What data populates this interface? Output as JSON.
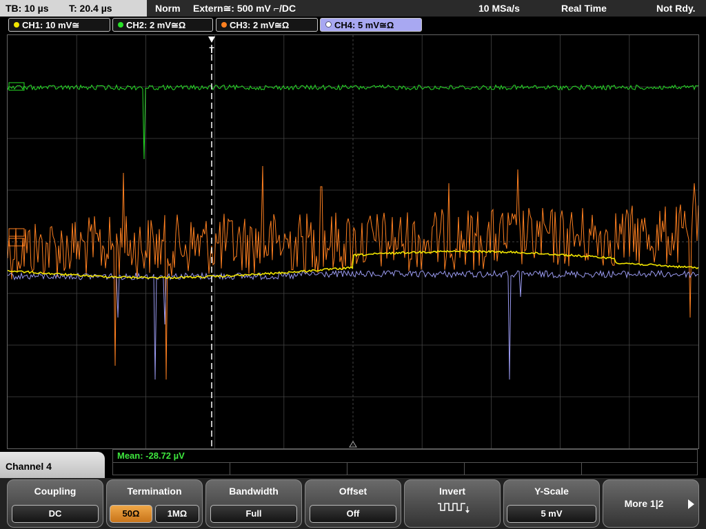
{
  "status": {
    "timebase": "TB: 10 µs",
    "trigger_time": "T: 20.4 µs",
    "mode": "Norm",
    "trigger_source": "Extern≅: 500 mV ⌐/DC",
    "sample_rate": "10 MSa/s",
    "acquisition": "Real Time",
    "state": "Not Rdy."
  },
  "channels": [
    {
      "label": "CH1: 10 mV≅",
      "color": "#f2e600"
    },
    {
      "label": "CH2: 2 mV≅Ω",
      "color": "#28e028"
    },
    {
      "label": "CH3: 2 mV≅Ω",
      "color": "#ff8020"
    },
    {
      "label": "CH4: 5 mV≅Ω",
      "color": "#9a9af0"
    }
  ],
  "measurement": {
    "label": "Mean: -28.72 µV"
  },
  "active_channel_title": "Channel 4",
  "menu": {
    "coupling": {
      "title": "Coupling",
      "value": "DC"
    },
    "termination": {
      "title": "Termination",
      "option_a": "50Ω",
      "option_b": "1MΩ"
    },
    "bandwidth": {
      "title": "Bandwidth",
      "value": "Full"
    },
    "offset": {
      "title": "Offset",
      "value": "Off"
    },
    "invert": {
      "title": "Invert",
      "icon": "inverted-square-wave-icon"
    },
    "yscale": {
      "title": "Y-Scale",
      "value": "5 mV"
    },
    "more": {
      "label": "More 1|2"
    }
  },
  "markers": {
    "trigger_marker": "T"
  },
  "colors": {
    "grid": "#444444",
    "trigger_line": "#ffffff"
  }
}
